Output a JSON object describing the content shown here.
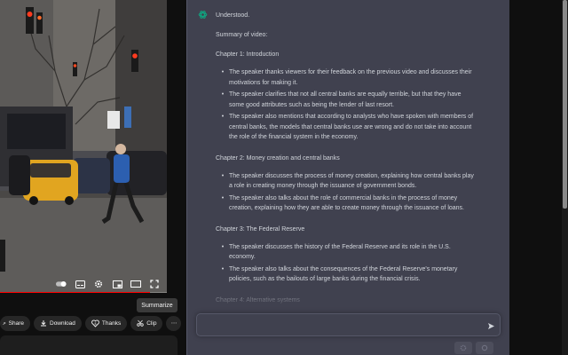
{
  "video": {
    "progress_fraction": 0.9,
    "controls": [
      "play-toggle-icon",
      "subtitles-icon",
      "settings-icon",
      "miniplayer-icon",
      "theater-icon",
      "fullscreen-icon"
    ]
  },
  "actions": {
    "summarize_label": "Summarize",
    "share_label": "Share",
    "download_label": "Download",
    "thanks_label": "Thanks",
    "clip_label": "Clip",
    "more_label": "⋯"
  },
  "chat": {
    "intro": "Understood.",
    "summary_heading": "Summary of video:",
    "chapters": [
      {
        "title": "Chapter 1: Introduction",
        "bullets": [
          [
            "The speaker thanks viewers for their feedback on the previous video and discusses their",
            "motivations for making it."
          ],
          [
            "The speaker clarifies that not all central banks are equally terrible, but that they have",
            "some good attributes such as being the lender of last resort."
          ],
          [
            "The speaker also mentions that according to analysts who have spoken with members of",
            "central banks, the models that central banks use are wrong and do not take into account",
            "the role of the financial system in the economy."
          ]
        ]
      },
      {
        "title": "Chapter 2: Money creation and central banks",
        "bullets": [
          [
            "The speaker discusses the process of money creation, explaining how central banks play",
            "a role in creating money through the issuance of government bonds."
          ],
          [
            "The speaker also talks about the role of commercial banks in the process of money",
            "creation, explaining how they are able to create money through the issuance of loans."
          ]
        ]
      },
      {
        "title": "Chapter 3: The Federal Reserve",
        "bullets": [
          [
            "The speaker discusses the history of the Federal Reserve and its role in the U.S.",
            "economy."
          ],
          [
            "The speaker also talks about the consequences of the Federal Reserve's monetary",
            "policies, such as the bailouts of large banks during the financial crisis."
          ]
        ]
      },
      {
        "title": "Chapter 4: Alternative systems",
        "bullets": []
      }
    ],
    "bullet_glyph": "•",
    "input_value": "",
    "input_placeholder": ""
  },
  "colors": {
    "panel_bg": "#40414f",
    "text": "#d1d5db",
    "openai_green": "#10a37f",
    "youtube_red": "#ff0000"
  },
  "icons": {
    "logo": "openai-logo-icon",
    "send": "send-icon"
  }
}
